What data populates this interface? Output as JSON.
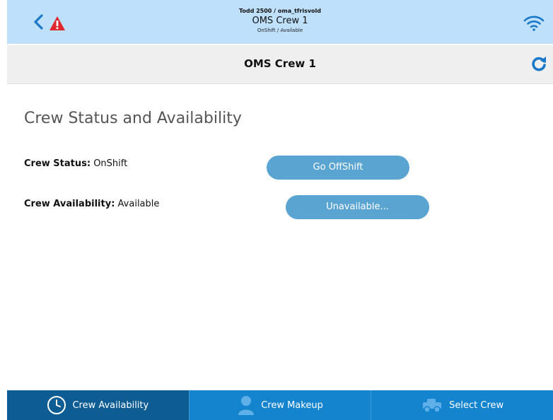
{
  "header": {
    "user_line": "Todd 2500 / oma_tfrisvold",
    "crew_name": "OMS Crew 1",
    "status_line": "OnShift / Available",
    "icons": [
      "back-icon",
      "warning-icon",
      "wifi-icon"
    ]
  },
  "title_bar": {
    "title": "OMS Crew 1",
    "icons": [
      "refresh-icon"
    ]
  },
  "main": {
    "heading": "Crew Status and Availability",
    "crew_status_label": "Crew Status:",
    "crew_status_value": "OnShift",
    "crew_status_button": "Go OffShift",
    "crew_availability_label": "Crew Availability:",
    "crew_availability_value": "Available",
    "crew_availability_button": "Unavailable..."
  },
  "tabs": [
    {
      "label": "Crew Availability",
      "icon": "clock-icon",
      "active": true
    },
    {
      "label": "Crew Makeup",
      "icon": "person-icon",
      "active": false
    },
    {
      "label": "Select Crew",
      "icon": "truck-icon",
      "active": false
    }
  ],
  "colors": {
    "top_bar": "#bfe0fb",
    "title_bar": "#efefef",
    "button": "#5aa4d2",
    "tab_bar": "#1484cf",
    "tab_active": "#0d5c93",
    "accent_icon": "#1a78c8",
    "warning": "#e0262e"
  }
}
